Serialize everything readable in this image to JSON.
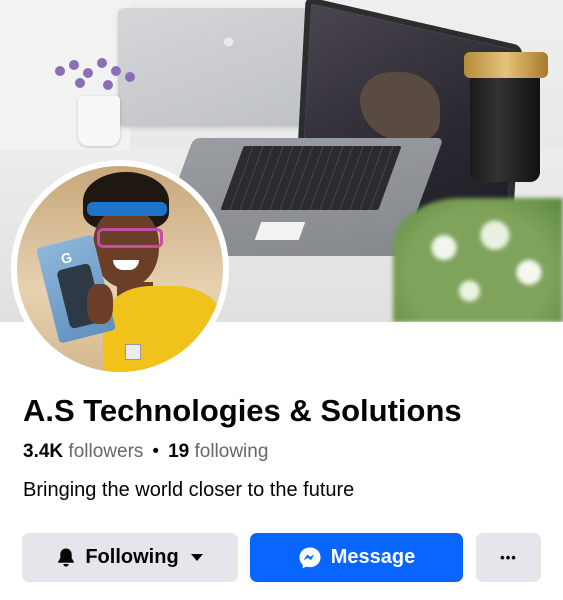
{
  "page": {
    "name": "A.S Technologies & Solutions",
    "followers_count": "3.4K",
    "followers_label": "followers",
    "separator": "•",
    "following_count": "19",
    "following_label": "following",
    "bio": "Bringing the world closer to the future"
  },
  "actions": {
    "following_label": "Following",
    "message_label": "Message",
    "more_label": "•••"
  },
  "icons": {
    "following": "bell-icon",
    "following_dropdown": "caret-down-icon",
    "message": "messenger-icon",
    "more": "more-icon"
  },
  "colors": {
    "primary": "#0866ff",
    "secondary_button": "#e4e6eb",
    "text_primary": "#050505",
    "text_secondary": "#65676b"
  }
}
